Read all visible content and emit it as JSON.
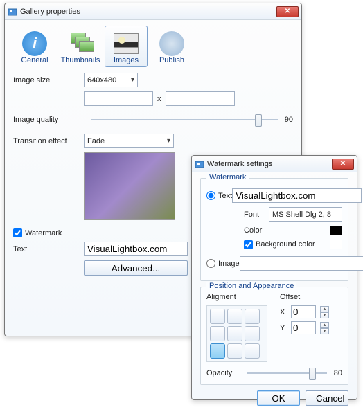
{
  "gallery": {
    "title": "Gallery properties",
    "tabs": [
      "General",
      "Thumbnails",
      "Images",
      "Publish"
    ],
    "image_size_label": "Image size",
    "image_size_value": "640x480",
    "width_value": "",
    "height_value": "",
    "x": "x",
    "quality_label": "Image quality",
    "quality_value": "90",
    "transition_label": "Transition effect",
    "transition_value": "Fade",
    "watermark_label": "Watermark",
    "text_label": "Text",
    "text_value": "VisualLightbox.com",
    "advanced_btn": "Advanced..."
  },
  "water": {
    "title": "Watermark settings",
    "group": "Watermark",
    "text_label": "Text",
    "text_value": "VisualLightbox.com",
    "font_label": "Font",
    "font_value": "MS Shell Dlg 2, 8",
    "color_label": "Color",
    "bg_label": "Background color",
    "image_label": "Image",
    "image_value": "",
    "pos_group": "Position and Appearance",
    "align_label": "Aligment",
    "offset_label": "Offset",
    "x_label": "X",
    "x_val": "0",
    "y_label": "Y",
    "y_val": "0",
    "opacity_label": "Opacity",
    "opacity_val": "80",
    "ok": "OK",
    "cancel": "Cancel",
    "browse": "..."
  }
}
